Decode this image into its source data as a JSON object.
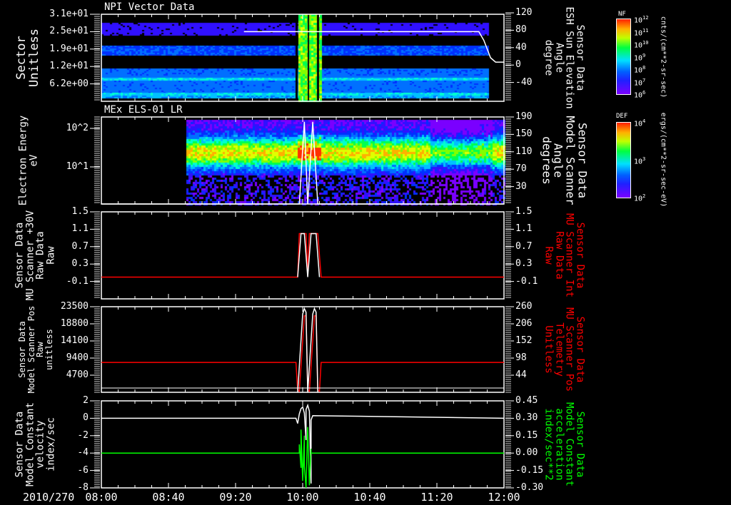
{
  "date_label": "2010/270",
  "time_axis": {
    "ticks": [
      "08:00",
      "08:40",
      "09:20",
      "10:00",
      "10:40",
      "11:20",
      "12:00"
    ]
  },
  "panels": [
    {
      "title": "NPI Vector Data",
      "left_label": "Sector\nUnitless",
      "right_label": "Sensor Data\nESH Sun Elevation\nAngle\ndegree",
      "right_label_color": "#ffffff",
      "left_ticks": [
        "3.1e+01",
        "2.5e+01",
        "1.9e+01",
        "1.2e+01",
        "6.2e+00"
      ],
      "right_ticks": [
        "120",
        "80",
        "40",
        "0",
        "-40"
      ]
    },
    {
      "title": "MEx ELS-01 LR",
      "left_label": "Electron Energy\neV",
      "right_label": "Sensor Data\nModel Scanner\nAngle\ndegrees",
      "right_label_color": "#ffffff",
      "left_ticks": [
        "10^2",
        "10^1"
      ],
      "right_ticks": [
        "190",
        "150",
        "110",
        "70",
        "30"
      ]
    },
    {
      "title": "",
      "left_label": "Sensor Data\nMU Scanner +30V\nRaw Data\nRaw",
      "right_label": "Sensor Data\nMU Scanner Int\nRaw Data\nRaw",
      "right_label_color": "#ff0000",
      "left_ticks": [
        "1.5",
        "1.1",
        "0.7",
        "0.3",
        "-0.1"
      ],
      "right_ticks": [
        "1.5",
        "1.1",
        "0.7",
        "0.3",
        "-0.1"
      ]
    },
    {
      "title": "",
      "left_label": "Sensor Data\nModel Scanner Pos\nRaw\nunitless",
      "right_label": "Sensor Data\nMU Scanner Pos\nTelemetry\nUnitless",
      "right_label_color": "#ff0000",
      "left_ticks": [
        "23500",
        "18800",
        "14100",
        "9400",
        "4700"
      ],
      "right_ticks": [
        "260",
        "206",
        "152",
        "98",
        "44"
      ]
    },
    {
      "title": "",
      "left_label": "Sensor Data\nModel Constant\nvelocity\nindex/sec",
      "right_label": "Sensor Data\nModel Constant\nacceleration\nindex/sec**2",
      "right_label_color": "#00ff00",
      "left_ticks": [
        "2",
        "0",
        "-2",
        "-4",
        "-6",
        "-8"
      ],
      "right_ticks": [
        "0.45",
        "0.30",
        "0.15",
        "0.00",
        "-0.15",
        "-0.30"
      ]
    }
  ],
  "colorbars": [
    {
      "title": "NF",
      "ticks": [
        "12",
        "11",
        "10",
        "9",
        "8",
        "7",
        "6"
      ],
      "units": "cnts/(cm**2-sr-sec)"
    },
    {
      "title": "DEF",
      "ticks": [
        "4",
        "3",
        "2"
      ],
      "units": "ergs/(cm**2-sr-sec-eV)"
    }
  ],
  "chart_data": [
    {
      "type": "heatmap",
      "title": "NPI Vector Data",
      "ylabel": "Sector Unitless",
      "ylim": [
        0,
        31
      ],
      "xlim": [
        "08:00",
        "12:00"
      ],
      "colorbar": "NF 1e6–1e12 cnts/(cm**2-sr-sec)",
      "y2label": "Sensor Data ESH Sun Elevation Angle degree",
      "y2lim": [
        -80,
        120
      ],
      "line_series": [
        {
          "color": "#ffffff",
          "points": [
            [
              "09:25",
              80
            ],
            [
              "11:45",
              80
            ],
            [
              "11:48",
              60
            ],
            [
              "11:52",
              20
            ],
            [
              "11:55",
              10
            ],
            [
              "12:00",
              10
            ]
          ]
        }
      ]
    },
    {
      "type": "heatmap",
      "title": "MEx ELS-01 LR",
      "ylabel": "Electron Energy eV",
      "yscale": "log",
      "ylim": [
        1,
        200
      ],
      "xlim": [
        "08:00",
        "12:00"
      ],
      "colorbar": "DEF 1e2–1e4 ergs/(cm**2-sr-sec-eV)",
      "data_start": "08:51",
      "peak_energy_range_eV": [
        20,
        40
      ],
      "y2label": "Sensor Data Model Scanner Angle degrees",
      "y2lim": [
        10,
        190
      ],
      "line_series": [
        {
          "color": "#ffffff",
          "points": [
            [
              "08:00",
              10
            ],
            [
              "09:58",
              10
            ],
            [
              "10:01",
              180
            ],
            [
              "10:03",
              10
            ],
            [
              "10:06",
              180
            ],
            [
              "10:09",
              10
            ],
            [
              "12:00",
              10
            ]
          ]
        }
      ]
    },
    {
      "type": "line",
      "ylim": [
        -0.5,
        1.5
      ],
      "series": [
        {
          "color": "#ff0000",
          "points": [
            [
              "08:00",
              0
            ],
            [
              "09:57",
              0
            ],
            [
              "09:58",
              1.0
            ],
            [
              "10:02",
              1.0
            ],
            [
              "10:03",
              0.1
            ],
            [
              "10:04",
              1.0
            ],
            [
              "10:09",
              1.0
            ],
            [
              "10:11",
              0
            ],
            [
              "12:00",
              0
            ]
          ]
        },
        {
          "color": "#ffffff",
          "points": [
            [
              "09:57",
              0
            ],
            [
              "09:59",
              1.0
            ],
            [
              "10:01",
              1.0
            ],
            [
              "10:03",
              0
            ],
            [
              "10:05",
              1.0
            ],
            [
              "10:08",
              1.0
            ],
            [
              "10:10",
              0
            ]
          ]
        }
      ]
    },
    {
      "type": "line",
      "ylim": [
        0,
        23500
      ],
      "y2lim": [
        0,
        260
      ],
      "series": [
        {
          "color": "#ff0000",
          "points": [
            [
              "08:00",
              8200
            ],
            [
              "09:56",
              8200
            ],
            [
              "09:57",
              600
            ],
            [
              "09:58",
              300
            ],
            [
              "10:01",
              21000
            ],
            [
              "10:02",
              21000
            ],
            [
              "10:03",
              600
            ],
            [
              "10:04",
              300
            ],
            [
              "10:07",
              21000
            ],
            [
              "10:08",
              21000
            ],
            [
              "10:09",
              600
            ],
            [
              "10:10",
              300
            ],
            [
              "10:11",
              8200
            ],
            [
              "12:00",
              8200
            ]
          ]
        },
        {
          "color": "#ffffff",
          "points": [
            [
              "09:57",
              0
            ],
            [
              "10:00",
              21500
            ],
            [
              "10:01",
              23000
            ],
            [
              "10:02",
              22000
            ],
            [
              "10:03",
              0
            ],
            [
              "10:06",
              21500
            ],
            [
              "10:07",
              23000
            ],
            [
              "10:08",
              22000
            ],
            [
              "10:09",
              0
            ]
          ]
        }
      ]
    },
    {
      "type": "line",
      "ylim": [
        -8,
        2
      ],
      "y2lim": [
        -0.3,
        0.45
      ],
      "series": [
        {
          "color": "#ffffff",
          "points": [
            [
              "08:00",
              0
            ],
            [
              "09:56",
              0
            ],
            [
              "09:57",
              -0.6
            ],
            [
              "09:58",
              0.5
            ],
            [
              "09:59",
              1.1
            ],
            [
              "10:00",
              1.3
            ],
            [
              "10:01",
              0.6
            ],
            [
              "10:02",
              -2.5
            ],
            [
              "10:02",
              1.0
            ],
            [
              "10:03",
              1.5
            ],
            [
              "10:04",
              0.8
            ],
            [
              "10:05",
              -7.5
            ],
            [
              "10:05",
              -0.2
            ],
            [
              "10:06",
              0.3
            ],
            [
              "12:00",
              0
            ]
          ]
        },
        {
          "color": "#00ff00",
          "points": [
            [
              "08:00",
              -4
            ],
            [
              "09:58",
              -4
            ],
            [
              "09:58",
              -3
            ],
            [
              "09:59",
              -5.7
            ],
            [
              "09:59",
              -1.3
            ],
            [
              "10:00",
              -7.2
            ],
            [
              "10:01",
              -2
            ],
            [
              "10:01",
              -5.5
            ],
            [
              "10:02",
              -8
            ],
            [
              "10:03",
              -1
            ],
            [
              "10:04",
              -7.7
            ],
            [
              "10:05",
              -3.5
            ],
            [
              "10:05",
              -4
            ],
            [
              "12:00",
              -4
            ]
          ]
        }
      ]
    }
  ]
}
